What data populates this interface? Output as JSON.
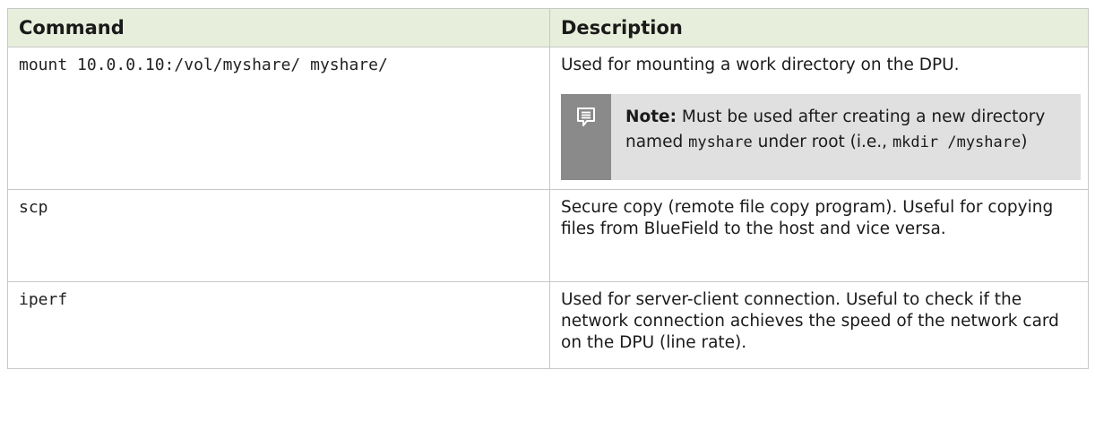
{
  "table": {
    "headers": {
      "command": "Command",
      "description": "Description"
    },
    "rows": [
      {
        "command": "mount 10.0.0.10:/vol/myshare/ myshare/",
        "description": "Used for mounting a work directory on the DPU.",
        "note": {
          "icon": "note-icon",
          "label": "Note:",
          "text_1": " Must be used after creating a new directory named ",
          "code_1": "myshare",
          "text_2": " under root (i.e., ",
          "code_2": "mkdir /myshare",
          "text_3": ")"
        }
      },
      {
        "command": "scp",
        "description": "Secure copy (remote file copy program). Useful for copying files from BlueField to the host and vice versa."
      },
      {
        "command": "iperf",
        "description": "Used for server-client connection. Useful to check if the network connection achieves the speed of the network card on the DPU (line rate)."
      }
    ]
  },
  "colors": {
    "header_bg": "#e8eedc",
    "note_bar": "#8a8a8a",
    "note_bg": "#e0e0e0",
    "border": "#c8c8c8"
  }
}
